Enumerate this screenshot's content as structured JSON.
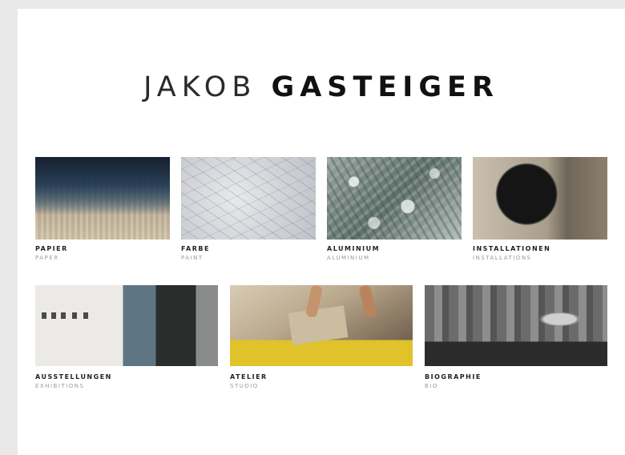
{
  "site": {
    "title_first": "JAKOB",
    "title_last": "GASTEIGER"
  },
  "tiles": [
    {
      "label": "PAPIER",
      "sublabel": "PAPER"
    },
    {
      "label": "FARBE",
      "sublabel": "PAINT"
    },
    {
      "label": "ALUMINIUM",
      "sublabel": "ALUMINIUM"
    },
    {
      "label": "INSTALLATIONEN",
      "sublabel": "INSTALLATIONS"
    },
    {
      "label": "AUSSTELLUNGEN",
      "sublabel": "EXHIBITIONS"
    },
    {
      "label": "ATELIER",
      "sublabel": "STUDIO"
    },
    {
      "label": "BIOGRAPHIE",
      "sublabel": "BIO"
    }
  ]
}
